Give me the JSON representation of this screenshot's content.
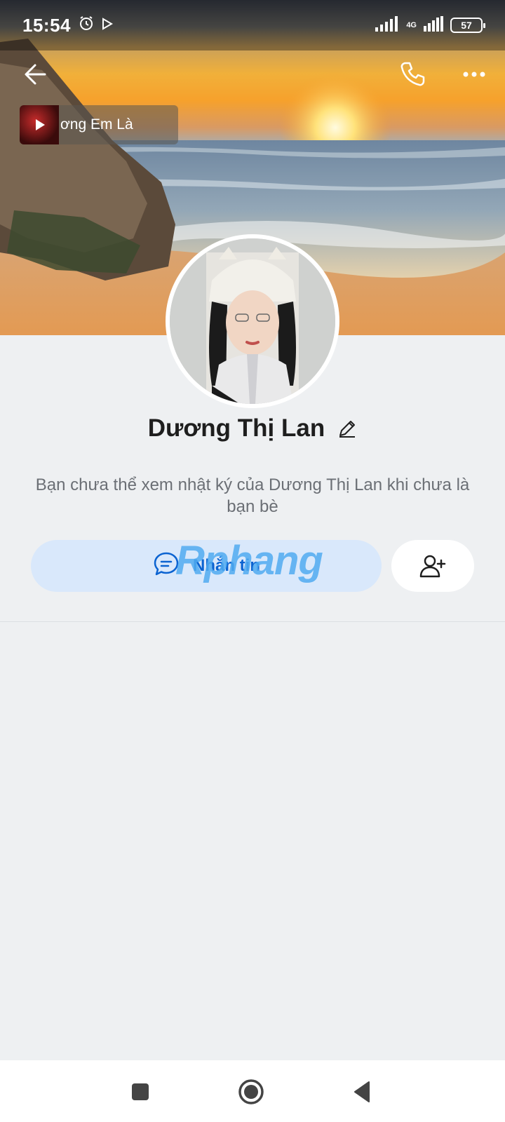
{
  "status_bar": {
    "time": "15:54",
    "network": "4G",
    "battery": "57",
    "icons": [
      "alarm-icon",
      "play-store-icon",
      "signal-icon",
      "signal-4g-icon",
      "battery-icon"
    ]
  },
  "header": {
    "back_icon": "arrow-left-icon",
    "call_icon": "phone-icon",
    "more_icon": "more-horizontal-icon"
  },
  "music": {
    "now_playing": "ơng        Em Là",
    "play_icon": "play-icon"
  },
  "profile": {
    "name": "Dương Thị Lan",
    "edit_icon": "pencil-icon"
  },
  "info": {
    "message": "Bạn chưa thể xem nhật ký của Dương Thị Lan khi chưa là bạn bè"
  },
  "actions": {
    "message_label": "Nhắn tin",
    "message_icon": "chat-bubble-icon",
    "add_friend_icon": "add-user-icon",
    "watermark": "Rphang"
  },
  "colors": {
    "accent": "#0b63d1",
    "message_button_bg": "#d9e8fb",
    "page_bg": "#eef0f2"
  },
  "nav": {
    "recent_icon": "square-icon",
    "home_icon": "circle-icon",
    "back_icon": "triangle-back-icon"
  }
}
